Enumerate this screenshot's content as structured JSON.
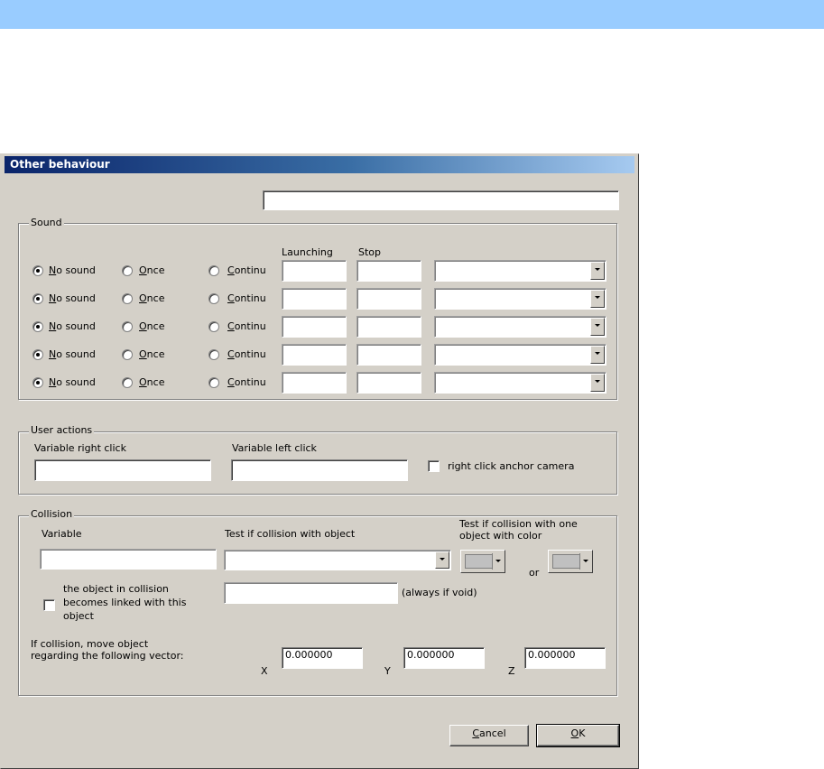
{
  "window": {
    "title": "Other behaviour"
  },
  "name_field": {
    "value": ""
  },
  "sound": {
    "group_label": "Sound",
    "launching_header": "Launching",
    "stop_header": "Stop",
    "rows": [
      {
        "no_sound_label": "No sound",
        "once_label": "Once",
        "continu_label": "Continu",
        "selected": "no_sound",
        "launching": "",
        "stop": "",
        "file": ""
      },
      {
        "no_sound_label": "No sound",
        "once_label": "Once",
        "continu_label": "Continu",
        "selected": "no_sound",
        "launching": "",
        "stop": "",
        "file": ""
      },
      {
        "no_sound_label": "No sound",
        "once_label": "Once",
        "continu_label": "Continu",
        "selected": "no_sound",
        "launching": "",
        "stop": "",
        "file": ""
      },
      {
        "no_sound_label": "No sound",
        "once_label": "Once",
        "continu_label": "Continu",
        "selected": "no_sound",
        "launching": "",
        "stop": "",
        "file": ""
      },
      {
        "no_sound_label": "No sound",
        "once_label": "Once",
        "continu_label": "Continu",
        "selected": "no_sound",
        "launching": "",
        "stop": "",
        "file": ""
      }
    ]
  },
  "user_actions": {
    "group_label": "User actions",
    "right_click_label": "Variable right click",
    "right_click_value": "",
    "left_click_label": "Variable left click",
    "left_click_value": "",
    "anchor_camera_label": "right click anchor camera",
    "anchor_camera_checked": false
  },
  "collision": {
    "group_label": "Collision",
    "variable_label": "Variable",
    "variable_value": "",
    "test_object_label": "Test if collision with object",
    "test_object_value": "",
    "test_color_label_1": "Test if collision with one",
    "test_color_label_2": "object with color",
    "or_label": "or",
    "color_1": "#c0c0c0",
    "color_2": "#c0c0c0",
    "linked_label_1": "the object in collision",
    "linked_label_2": "becomes linked with this",
    "linked_label_3": "object",
    "linked_checked": false,
    "linked_value": "",
    "always_if_void_label": "(always if void)",
    "move_label_1": "If collision, move object",
    "move_label_2": "regarding the following vector:",
    "x_label": "X",
    "x_value": "0.000000",
    "y_label": "Y",
    "y_value": "0.000000",
    "z_label": "Z",
    "z_value": "0.000000"
  },
  "buttons": {
    "cancel": "Cancel",
    "ok": "OK"
  }
}
